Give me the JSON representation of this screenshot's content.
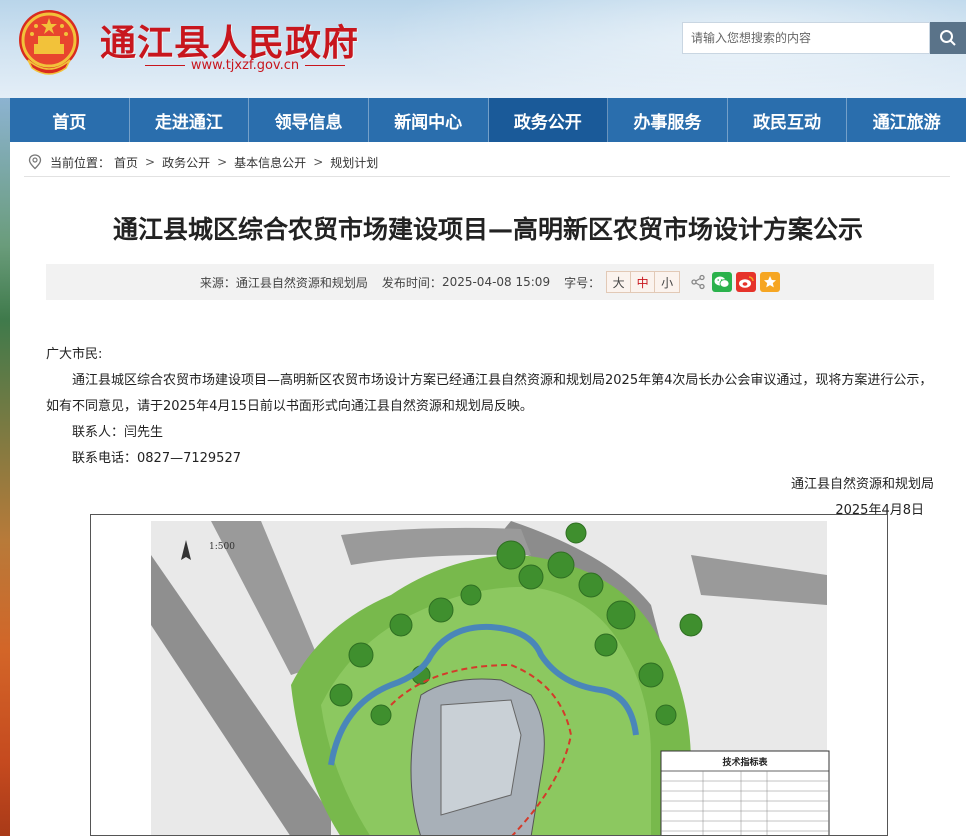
{
  "header": {
    "site_title": "通江县人民政府",
    "site_url": "www.tjxzf.gov.cn",
    "emblem": "national-emblem-icon",
    "search": {
      "placeholder": "请输入您想搜索的内容",
      "icon": "search-icon"
    }
  },
  "nav": {
    "items": [
      {
        "label": "首页"
      },
      {
        "label": "走进通江"
      },
      {
        "label": "领导信息"
      },
      {
        "label": "新闻中心"
      },
      {
        "label": "政务公开",
        "active": true
      },
      {
        "label": "办事服务"
      },
      {
        "label": "政民互动"
      },
      {
        "label": "通江旅游"
      }
    ]
  },
  "breadcrumb": {
    "prefix": "当前位置：",
    "items": [
      "首页",
      "政务公开",
      "基本信息公开",
      "规划计划"
    ]
  },
  "article": {
    "title": "通江县城区综合农贸市场建设项目—高明新区农贸市场设计方案公示",
    "meta": {
      "source_label": "来源：",
      "source": "通江县自然资源和规划局",
      "time_label": "发布时间：",
      "time": "2025-04-08 15:09",
      "font_label": "字号：",
      "font_sizes": [
        "大",
        "中",
        "小"
      ]
    },
    "greeting": "广大市民:",
    "paragraph": "通江县城区综合农贸市场建设项目—高明新区农贸市场设计方案已经通江县自然资源和规划局2025年第4次局长办公会审议通过，现将方案进行公示，如有不同意见，请于2025年4月15日前以书面形式向通江县自然资源和规划局反映。",
    "contact": "联系人：闫先生",
    "phone": "联系电话：0827—7129527",
    "signature": "通江县自然资源和规划局",
    "date": "2025年4月8日"
  },
  "plan_image": {
    "scale_label": "1:500",
    "table_title": "技术指标表"
  },
  "colors": {
    "brand_red": "#c8161d",
    "nav_blue": "#2a6ead",
    "nav_active": "#1a5a99"
  }
}
